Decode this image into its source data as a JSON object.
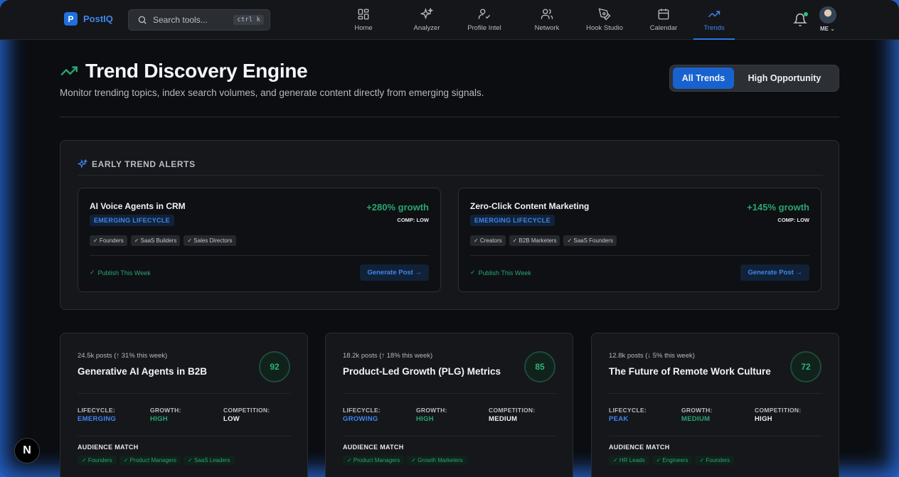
{
  "brand": {
    "logo_letter": "P",
    "name": "PostIQ"
  },
  "search": {
    "placeholder": "Search tools...",
    "shortcut": "ctrl k"
  },
  "nav": {
    "items": [
      {
        "label": "Home",
        "icon": "home-grid-icon"
      },
      {
        "label": "Analyzer",
        "icon": "sparkle-icon"
      },
      {
        "label": "Profile Intel",
        "icon": "user-check-icon"
      },
      {
        "label": "Network",
        "icon": "users-icon"
      },
      {
        "label": "Hook Studio",
        "icon": "pen-tool-icon"
      },
      {
        "label": "Calendar",
        "icon": "calendar-icon"
      },
      {
        "label": "Trends",
        "icon": "trending-up-icon",
        "active": true
      }
    ],
    "user_label": "ME"
  },
  "header": {
    "title": "Trend Discovery Engine",
    "subtitle": "Monitor trending topics, index search volumes, and generate content directly from emerging signals.",
    "filter": {
      "all": "All Trends",
      "high": "High Opportunity",
      "selected": "All Trends"
    }
  },
  "alerts": {
    "title": "EARLY TREND ALERTS",
    "cards": [
      {
        "name": "AI Voice Agents in CRM",
        "lifecycle": "EMERGING LIFECYCLE",
        "growth": "+280% growth",
        "comp": "COMP: LOW",
        "tags": [
          "✓ Founders",
          "✓ SaaS Builders",
          "✓ Sales Directors"
        ],
        "publish": "Publish This Week",
        "button": "Generate Post →"
      },
      {
        "name": "Zero-Click Content Marketing",
        "lifecycle": "EMERGING LIFECYCLE",
        "growth": "+145% growth",
        "comp": "COMP: LOW",
        "tags": [
          "✓ Creators",
          "✓ B2B Marketers",
          "✓ SaaS Founders"
        ],
        "publish": "Publish This Week",
        "button": "Generate Post →"
      }
    ]
  },
  "labels": {
    "lifecycle": "LIFECYCLE:",
    "growth": "GROWTH:",
    "competition": "COMPETITION:",
    "audience_match": "AUDIENCE MATCH"
  },
  "trends": [
    {
      "posts": "24.5k posts (↑ 31% this week)",
      "name": "Generative AI Agents in B2B",
      "score": "92",
      "lifecycle": "EMERGING",
      "growth": "HIGH",
      "competition": "LOW",
      "audience": [
        "✓ Founders",
        "✓ Product Managers",
        "✓ SaaS Leaders"
      ]
    },
    {
      "posts": "18.2k posts (↑ 18% this week)",
      "name": "Product-Led Growth (PLG) Metrics",
      "score": "85",
      "lifecycle": "GROWING",
      "growth": "HIGH",
      "competition": "MEDIUM",
      "audience": [
        "✓ Product Managers",
        "✓ Growth Marketers"
      ]
    },
    {
      "posts": "12.8k posts (↓ 5% this week)",
      "name": "The Future of Remote Work Culture",
      "score": "72",
      "lifecycle": "PEAK",
      "growth": "MEDIUM",
      "competition": "HIGH",
      "audience": [
        "✓ HR Leads",
        "✓ Engineers",
        "✓ Founders"
      ]
    }
  ],
  "floating_badge": "N",
  "colors": {
    "accent": "#1862d0",
    "brand": "#3f86f0",
    "success": "#2aa572",
    "background": "#0b0d10",
    "frame_glow": "#1f5fc4"
  }
}
